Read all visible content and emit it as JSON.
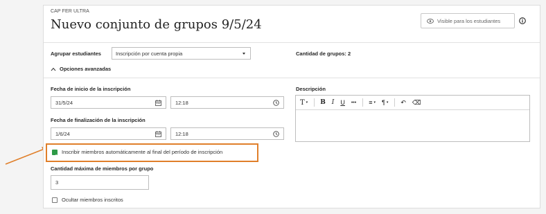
{
  "header": {
    "course": "CAP FER ULTRA",
    "title": "Nuevo conjunto de grupos 9/5/24",
    "visible_label": "Visible para los estudiantes"
  },
  "grouping": {
    "label": "Agrupar estudiantes",
    "selected": "Inscripción por cuenta propia",
    "group_count": "Cantidad de grupos: 2",
    "advanced_label": "Opciones avanzadas"
  },
  "enrollment": {
    "start_label": "Fecha de inicio de la inscripción",
    "start_date": "31/5/24",
    "start_time": "12:18",
    "end_label": "Fecha de finalización de la inscripción",
    "end_date": "1/6/24",
    "end_time": "12:18"
  },
  "description": {
    "label": "Descripción",
    "toolbar": [
      "T",
      "B",
      "I",
      "U",
      "•••",
      "≡",
      "¶",
      "↶",
      "⌫"
    ]
  },
  "auto_enroll": {
    "label": "Inscribir miembros automáticamente al final del período de inscripción",
    "checked": true
  },
  "max_members": {
    "label": "Cantidad máxima de miembros por grupo",
    "value": "3"
  },
  "hide_members": {
    "label": "Ocultar miembros inscritos",
    "checked": false
  },
  "colors": {
    "highlight": "#e07f2a",
    "checkbox_on": "#2e9a47"
  }
}
